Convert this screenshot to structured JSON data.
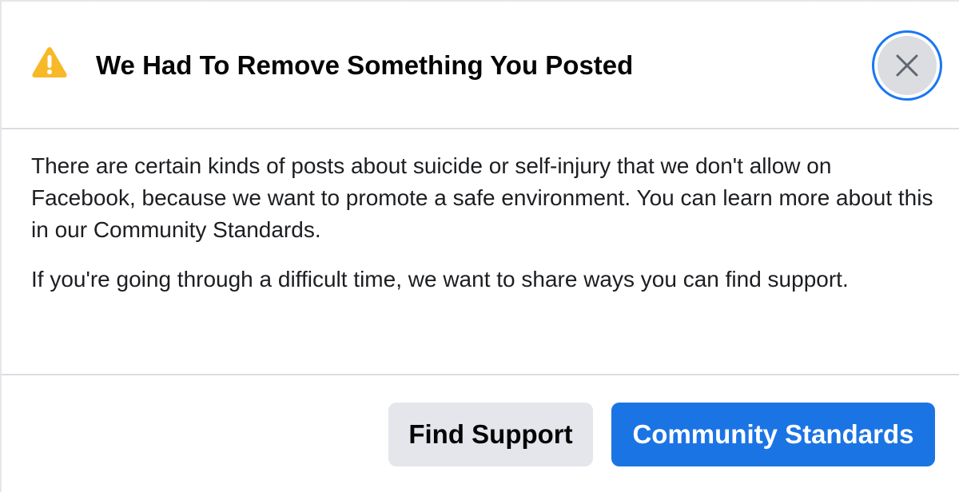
{
  "dialog": {
    "title": "We Had To Remove Something You Posted",
    "warning_icon": "warning-triangle-icon",
    "close_icon": "close-icon",
    "paragraphs": [
      "There are certain kinds of posts about suicide or self-injury that we don't allow on Facebook, because we want to promote a safe environment. You can learn more about this in our Community Standards.",
      "If you're going through a difficult time, we want to share ways you can find support."
    ],
    "buttons": {
      "find_support": "Find Support",
      "community_standards": "Community Standards"
    }
  },
  "colors": {
    "accent": "#1b74e4",
    "focus_ring": "#1877f2",
    "warning": "#f7b928",
    "secondary_button": "#e4e6eb"
  }
}
